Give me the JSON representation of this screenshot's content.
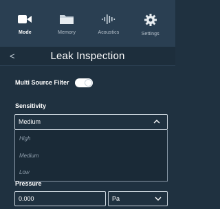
{
  "nav": {
    "tabs": [
      {
        "label": "Mode",
        "icon": "camera-icon",
        "active": true
      },
      {
        "label": "Memory",
        "icon": "folder-icon",
        "active": false
      },
      {
        "label": "Acoustics",
        "icon": "waveform-icon",
        "active": false
      },
      {
        "label": "Settings",
        "icon": "gear-icon",
        "active": false
      }
    ]
  },
  "header": {
    "back_glyph": "<",
    "title": "Leak Inspection"
  },
  "multi_source": {
    "label": "Multi Source Filter",
    "enabled": true
  },
  "sensitivity": {
    "label": "Sensitivity",
    "selected": "Medium",
    "options": [
      "High",
      "Medium",
      "Low"
    ]
  },
  "pressure": {
    "label": "Pressure",
    "value": "0.000",
    "unit": "Pa"
  },
  "colors": {
    "background": "#1f3140",
    "nav_bg": "#2a3f52",
    "text": "#ffffff",
    "muted": "#8f9eac"
  }
}
